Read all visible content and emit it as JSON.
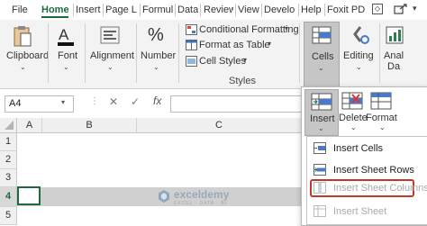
{
  "tabs": [
    "File",
    "Home",
    "Insert",
    "Page La",
    "Formul",
    "Data",
    "Review",
    "View",
    "Develo",
    "Help",
    "Foxit PD"
  ],
  "ribbon": {
    "clipboard": "Clipboard",
    "font": "Font",
    "alignment": "Alignment",
    "number": "Number",
    "conditional_formatting": "Conditional Formatting",
    "format_as_table": "Format as Table",
    "cell_styles": "Cell Styles",
    "styles_group": "Styles",
    "cells": "Cells",
    "editing": "Editing",
    "analyze": "Anal",
    "analyze2": "Da"
  },
  "formula_bar": {
    "name_box": "A4",
    "fx": "fx",
    "cancel": "✕",
    "enter": "✓"
  },
  "grid": {
    "columns": [
      "A",
      "B",
      "C"
    ],
    "rows": [
      "1",
      "2",
      "3",
      "4",
      "5"
    ]
  },
  "watermark": {
    "name": "exceldemy",
    "tagline": "EXCEL · DATA · BI"
  },
  "cells_menu": {
    "insert": "Insert",
    "delete": "Delete",
    "format": "Format",
    "items": [
      "Insert Cells",
      "Insert Sheet Rows",
      "Insert Sheet Columns",
      "Insert Sheet"
    ]
  },
  "colors": {
    "accent": "#1e6b3c",
    "highlight": "#c0392b",
    "selection_row": "#cfcfcf"
  }
}
